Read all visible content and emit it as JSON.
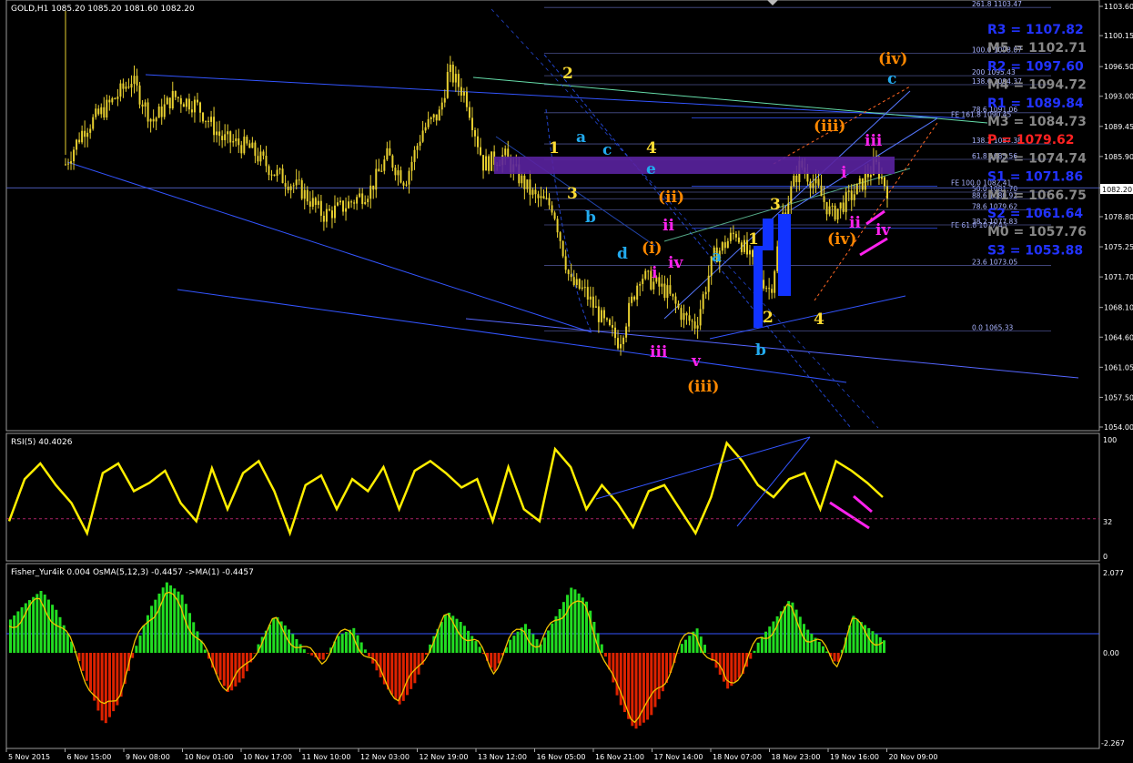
{
  "header": {
    "symbol_info": "GOLD,H1  1085.20 1085.20 1081.60 1082.20",
    "current_price": "1082.20"
  },
  "price_axis": {
    "labels": [
      "1103.60",
      "1100.15",
      "1096.50",
      "1093.00",
      "1089.45",
      "1085.90",
      "1082.20",
      "1078.80",
      "1075.25",
      "1071.70",
      "1068.10",
      "1064.60",
      "1061.05",
      "1057.50",
      "1054.00"
    ]
  },
  "time_axis": {
    "labels": [
      "5 Nov 2015",
      "6 Nov 15:00",
      "9 Nov 08:00",
      "10 Nov 01:00",
      "10 Nov 17:00",
      "11 Nov 10:00",
      "12 Nov 03:00",
      "12 Nov 19:00",
      "13 Nov 12:00",
      "16 Nov 05:00",
      "16 Nov 21:00",
      "17 Nov 14:00",
      "18 Nov 07:00",
      "18 Nov 23:00",
      "19 Nov 16:00",
      "20 Nov 09:00"
    ]
  },
  "pivots": [
    {
      "label": "R3 = 1107.82",
      "color": "#2233ff"
    },
    {
      "label": "M5 = 1102.71",
      "color": "#888888"
    },
    {
      "label": "R2 = 1097.60",
      "color": "#2233ff"
    },
    {
      "label": "M4 = 1094.72",
      "color": "#888888"
    },
    {
      "label": "R1 = 1089.84",
      "color": "#2233ff"
    },
    {
      "label": "M3 = 1084.73",
      "color": "#888888"
    },
    {
      "label": "P = 1079.62",
      "color": "#ff2222"
    },
    {
      "label": "M2 = 1074.74",
      "color": "#888888"
    },
    {
      "label": "S1 = 1071.86",
      "color": "#2233ff"
    },
    {
      "label": "M1 = 1066.75",
      "color": "#888888"
    },
    {
      "label": "S2 = 1061.64",
      "color": "#2233ff"
    },
    {
      "label": "M0 = 1057.76",
      "color": "#888888"
    },
    {
      "label": "S3 = 1053.88",
      "color": "#2233ff"
    }
  ],
  "fib_levels": [
    "261.8 1103.47",
    "100.0 1098.07",
    "200 1095.43",
    "138.6 1094.37",
    "78.6 1091.06",
    "FE 161.8 1090.45",
    "138.2 1087.38",
    "61.8 1085.56",
    "FE 100.0 1082.41",
    "50.0 1081.70",
    "88.6 1080.92",
    "78.6 1079.62",
    "FE 61.8 1077.43",
    "38.2 1077.83",
    "23.6 1073.05",
    "0.0 1065.33"
  ],
  "wave_labels": [
    {
      "text": "2",
      "color": "#ffdd33"
    },
    {
      "text": "1",
      "color": "#ffdd33"
    },
    {
      "text": "3",
      "color": "#ffdd33"
    },
    {
      "text": "4",
      "color": "#ffdd33"
    },
    {
      "text": "a",
      "color": "#22aaee"
    },
    {
      "text": "c",
      "color": "#22aaee"
    },
    {
      "text": "b",
      "color": "#22aaee"
    },
    {
      "text": "d",
      "color": "#22aaee"
    },
    {
      "text": "e",
      "color": "#22aaee"
    },
    {
      "text": "(ii)",
      "color": "#ff8800"
    },
    {
      "text": "(i)",
      "color": "#ff8800"
    },
    {
      "text": "ii",
      "color": "#ff22ee"
    },
    {
      "text": "i",
      "color": "#ff22ee"
    },
    {
      "text": "iv",
      "color": "#ff22ee"
    },
    {
      "text": "iii",
      "color": "#ff22ee"
    },
    {
      "text": "v",
      "color": "#ff22ee"
    },
    {
      "text": "(iii)",
      "color": "#ff8800"
    },
    {
      "text": "a",
      "color": "#22aaee"
    },
    {
      "text": "b",
      "color": "#22aaee"
    },
    {
      "text": "1",
      "color": "#ffdd33"
    },
    {
      "text": "2",
      "color": "#ffdd33"
    },
    {
      "text": "3",
      "color": "#ffdd33"
    },
    {
      "text": "4",
      "color": "#ffdd33"
    },
    {
      "text": "(iii)",
      "color": "#ff8800"
    },
    {
      "text": "(iv)",
      "color": "#ff8800"
    },
    {
      "text": "i",
      "color": "#ff22ee"
    },
    {
      "text": "ii",
      "color": "#ff22ee"
    },
    {
      "text": "iii",
      "color": "#ff22ee"
    },
    {
      "text": "iv",
      "color": "#ff22ee"
    },
    {
      "text": "(iv)",
      "color": "#ff8800"
    },
    {
      "text": "c",
      "color": "#22aaee"
    }
  ],
  "rsi_panel": {
    "title": "RSI(5) 40.4026",
    "axis_labels": [
      "100",
      "32",
      "0"
    ],
    "level_value": 32
  },
  "fisher_panel": {
    "title": "Fisher_Yur4ik 0.004  OsMA(5,12,3) -0.4457  ->MA(1) -0.4457",
    "axis_labels": [
      "2.077",
      "0.00",
      "-2.267"
    ]
  },
  "chart_data": [
    {
      "type": "candlestick",
      "title": "GOLD,H1",
      "ylim": [
        1054.0,
        1105.0
      ],
      "series": [
        {
          "name": "GOLD,H1",
          "values": []
        }
      ],
      "last": {
        "open": 1085.2,
        "high": 1085.2,
        "low": 1081.6,
        "close": 1082.2
      },
      "path_points": [
        [
          0,
          1085
        ],
        [
          10,
          1089
        ],
        [
          25,
          1092
        ],
        [
          38,
          1095
        ],
        [
          50,
          1090
        ],
        [
          62,
          1093
        ],
        [
          75,
          1092
        ],
        [
          90,
          1088
        ],
        [
          105,
          1087
        ],
        [
          120,
          1084
        ],
        [
          135,
          1082
        ],
        [
          148,
          1079
        ],
        [
          160,
          1080
        ],
        [
          175,
          1082
        ],
        [
          185,
          1086
        ],
        [
          195,
          1083
        ],
        [
          205,
          1089
        ],
        [
          215,
          1091
        ],
        [
          220,
          1096
        ],
        [
          230,
          1093
        ],
        [
          240,
          1085
        ],
        [
          252,
          1086
        ],
        [
          262,
          1083
        ],
        [
          270,
          1081
        ],
        [
          280,
          1080
        ],
        [
          290,
          1071
        ],
        [
          298,
          1070
        ],
        [
          310,
          1066
        ],
        [
          318,
          1064
        ],
        [
          330,
          1072
        ],
        [
          345,
          1070
        ],
        [
          355,
          1067
        ],
        [
          362,
          1066
        ],
        [
          372,
          1074
        ],
        [
          385,
          1077
        ],
        [
          395,
          1073
        ],
        [
          405,
          1070
        ],
        [
          412,
          1079
        ],
        [
          422,
          1085
        ],
        [
          432,
          1082
        ],
        [
          440,
          1079
        ],
        [
          455,
          1082
        ],
        [
          465,
          1085
        ],
        [
          472,
          1082
        ]
      ]
    },
    {
      "type": "line",
      "title": "RSI(5) 40.4026",
      "ylim": [
        0,
        100
      ],
      "series": [
        {
          "name": "RSI(5)",
          "values": [
            30,
            65,
            78,
            60,
            45,
            20,
            70,
            78,
            55,
            62,
            72,
            45,
            30,
            74,
            40,
            70,
            80,
            55,
            20,
            60,
            68,
            40,
            65,
            55,
            75,
            40,
            72,
            80,
            70,
            58,
            65,
            30,
            75,
            40,
            30,
            90,
            75,
            40,
            60,
            45,
            25,
            55,
            60,
            40,
            20,
            50,
            95,
            80,
            60,
            50,
            65,
            70,
            40,
            80,
            72,
            62,
            50
          ]
        }
      ]
    },
    {
      "type": "bar",
      "title": "OsMA(5,12,3)",
      "ylim": [
        -2.267,
        2.077
      ],
      "series": [
        {
          "name": "OsMA(5,12,3)",
          "values": [
            0.8,
            1.2,
            1.5,
            1.0,
            0.2,
            -0.8,
            -1.8,
            -1.2,
            0.1,
            1.1,
            1.7,
            1.4,
            0.5,
            -0.4,
            -1.0,
            -0.6,
            0.3,
            0.9,
            0.5,
            0.0,
            -0.2,
            0.4,
            0.6,
            -0.1,
            -0.8,
            -1.3,
            -0.7,
            0.3,
            1.0,
            0.7,
            0.2,
            -0.5,
            0.3,
            0.7,
            0.2,
            0.9,
            1.6,
            1.2,
            0.1,
            -1.2,
            -1.9,
            -1.6,
            -0.8,
            0.2,
            0.6,
            -0.2,
            -0.9,
            -0.5,
            0.3,
            0.8,
            1.3,
            0.6,
            0.2,
            -0.3,
            0.9,
            0.6,
            0.3
          ]
        }
      ]
    }
  ]
}
